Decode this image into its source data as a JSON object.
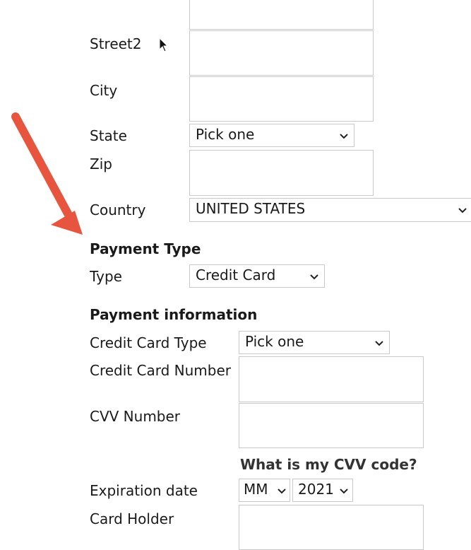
{
  "address": {
    "street2_label": "Street2",
    "city_label": "City",
    "state_label": "State",
    "state_selected": "Pick one",
    "zip_label": "Zip",
    "country_label": "Country",
    "country_selected": "UNITED STATES"
  },
  "payment_type": {
    "heading": "Payment Type",
    "type_label": "Type",
    "type_selected": "Credit Card"
  },
  "payment_info": {
    "heading": "Payment information",
    "card_type_label": "Credit Card Type",
    "card_type_selected": "Pick one",
    "card_number_label": "Credit Card Number",
    "cvv_label": "CVV Number",
    "cvv_help_link": "What is my CVV code?",
    "expiration_label": "Expiration date",
    "exp_month_selected": "MM",
    "exp_year_selected": "2021",
    "card_holder_label": "Card Holder"
  },
  "annotation": {
    "arrow_color": "#e8553f"
  }
}
